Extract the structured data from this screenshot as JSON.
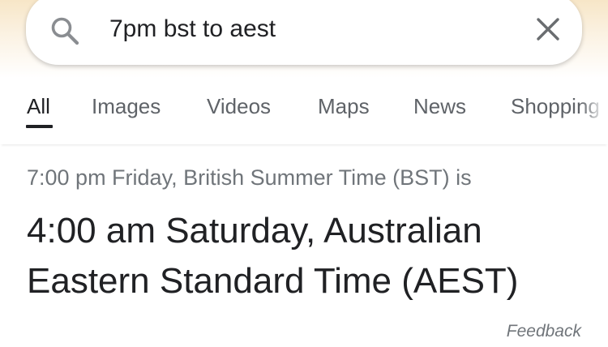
{
  "search": {
    "query": "7pm bst to aest",
    "search_icon": "search-icon",
    "clear_icon": "close-icon"
  },
  "tabs": [
    {
      "label": "All",
      "active": true
    },
    {
      "label": "Images",
      "active": false
    },
    {
      "label": "Videos",
      "active": false
    },
    {
      "label": "Maps",
      "active": false
    },
    {
      "label": "News",
      "active": false
    },
    {
      "label": "Shopping",
      "active": false
    }
  ],
  "result": {
    "source_line": "7:00 pm Friday, British Summer Time (BST) is",
    "converted_time": "4:00 am Saturday, Australian Eastern Standard Time (AEST)"
  },
  "feedback_label": "Feedback",
  "colors": {
    "text_primary": "#202124",
    "text_secondary": "#70757a",
    "tab_inactive": "#5f6368",
    "header_tint": "#f7e6c7"
  }
}
